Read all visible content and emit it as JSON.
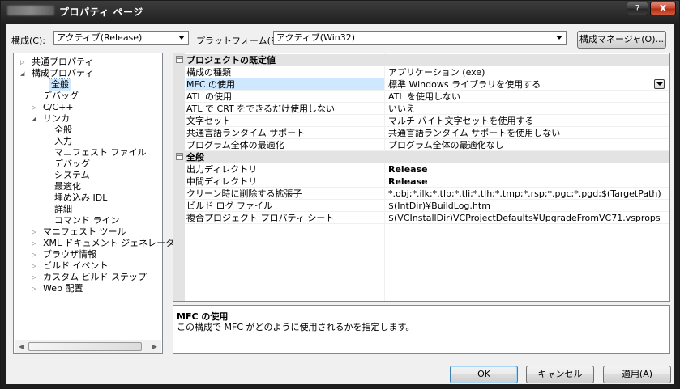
{
  "window": {
    "title": "プロパティ ページ",
    "help_label": "?",
    "close_label": "X"
  },
  "toolbar": {
    "config_label": "構成(C):",
    "config_value": "アクティブ(Release)",
    "platform_label": "プラットフォーム(P):",
    "platform_value": "アクティブ(Win32)",
    "config_manager_label": "構成マネージャ(O)..."
  },
  "tree": {
    "items": [
      {
        "label": "共通プロパティ",
        "twisty": "▷"
      },
      {
        "label": "構成プロパティ",
        "twisty": "◢"
      },
      {
        "label": "全般",
        "twisty": ""
      },
      {
        "label": "デバッグ",
        "twisty": ""
      },
      {
        "label": "C/C++",
        "twisty": "▷"
      },
      {
        "label": "リンカ",
        "twisty": "◢"
      },
      {
        "label": "全般",
        "twisty": ""
      },
      {
        "label": "入力",
        "twisty": ""
      },
      {
        "label": "マニフェスト ファイル",
        "twisty": ""
      },
      {
        "label": "デバッグ",
        "twisty": ""
      },
      {
        "label": "システム",
        "twisty": ""
      },
      {
        "label": "最適化",
        "twisty": ""
      },
      {
        "label": "埋め込み IDL",
        "twisty": ""
      },
      {
        "label": "詳細",
        "twisty": ""
      },
      {
        "label": "コマンド ライン",
        "twisty": ""
      },
      {
        "label": "マニフェスト ツール",
        "twisty": "▷"
      },
      {
        "label": "XML ドキュメント ジェネレータ",
        "twisty": "▷"
      },
      {
        "label": "ブラウザ情報",
        "twisty": "▷"
      },
      {
        "label": "ビルド イベント",
        "twisty": "▷"
      },
      {
        "label": "カスタム ビルド ステップ",
        "twisty": "▷"
      },
      {
        "label": "Web 配置",
        "twisty": "▷"
      }
    ]
  },
  "grid": {
    "categories": [
      {
        "title": "プロジェクトの既定値",
        "toggle": "⊟",
        "rows": [
          {
            "key": "構成の種類",
            "value": "アプリケーション (exe)"
          },
          {
            "key": "MFC の使用",
            "value": "標準 Windows ライブラリを使用する"
          },
          {
            "key": "ATL の使用",
            "value": "ATL を使用しない"
          },
          {
            "key": "ATL で CRT をできるだけ使用しない",
            "value": "いいえ"
          },
          {
            "key": "文字セット",
            "value": "マルチ バイト文字セットを使用する"
          },
          {
            "key": "共通言語ランタイム サポート",
            "value": "共通言語ランタイム サポートを使用しない"
          },
          {
            "key": "プログラム全体の最適化",
            "value": "プログラム全体の最適化なし"
          }
        ]
      },
      {
        "title": "全般",
        "toggle": "⊟",
        "rows": [
          {
            "key": "出力ディレクトリ",
            "value": "Release"
          },
          {
            "key": "中間ディレクトリ",
            "value": "Release"
          },
          {
            "key": "クリーン時に削除する拡張子",
            "value": "*.obj;*.ilk;*.tlb;*.tli;*.tlh;*.tmp;*.rsp;*.pgc;*.pgd;$(TargetPath)"
          },
          {
            "key": "ビルド ログ ファイル",
            "value": "$(IntDir)¥BuildLog.htm"
          },
          {
            "key": "複合プロジェクト プロパティ シート",
            "value": "$(VCInstallDir)VCProjectDefaults¥UpgradeFromVC71.vsprops"
          }
        ]
      }
    ]
  },
  "description": {
    "title": "MFC の使用",
    "text": "この構成で MFC がどのように使用されるかを指定します。"
  },
  "buttons": {
    "ok": "OK",
    "cancel": "キャンセル",
    "apply": "適用(A)"
  },
  "colors": {
    "selection": "#cde8ff",
    "category_bg": "#e3e3e3",
    "close_button": "#c8452e"
  }
}
